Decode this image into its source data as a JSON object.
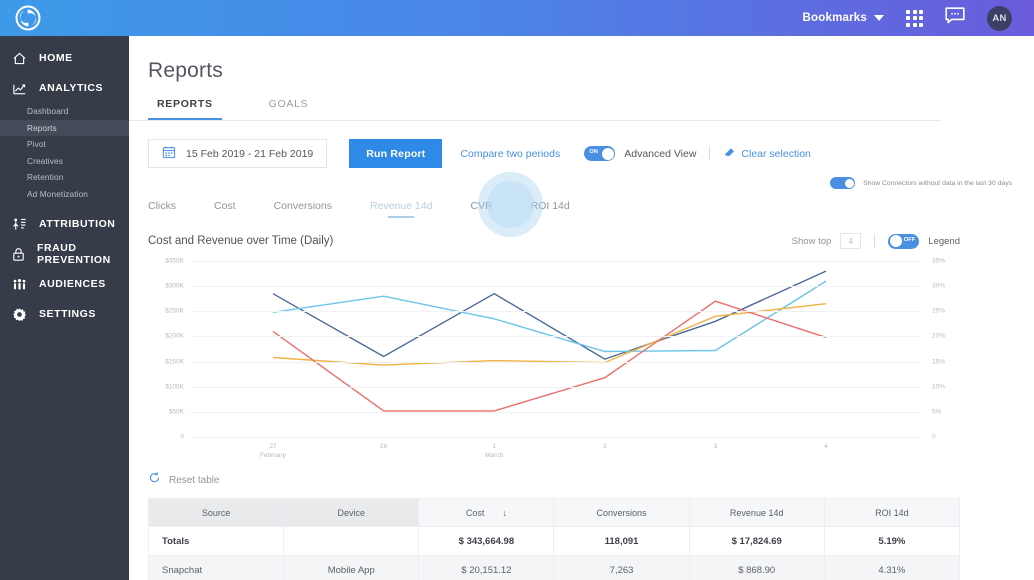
{
  "topbar": {
    "logo_name": "app-logo",
    "bookmarks_label": "Bookmarks",
    "grid_icon": "apps-grid-icon",
    "chat_icon": "chat-bubble-icon",
    "avatar_initials": "AN"
  },
  "sidebar": {
    "items": [
      {
        "label": "HOME",
        "icon": "home-icon",
        "key": "home"
      },
      {
        "label": "ANALYTICS",
        "icon": "analytics-chart-icon",
        "key": "analytics"
      },
      {
        "label": "ATTRIBUTION",
        "icon": "attribution-icon",
        "key": "attribution"
      },
      {
        "label": "FRAUD PREVENTION",
        "icon": "lock-icon",
        "key": "fraud-prevention"
      },
      {
        "label": "AUDIENCES",
        "icon": "people-icon",
        "key": "audiences"
      },
      {
        "label": "SETTINGS",
        "icon": "gear-icon",
        "key": "settings"
      }
    ],
    "analytics_sub": [
      {
        "label": "Dashboard",
        "key": "dashboard",
        "active": false
      },
      {
        "label": "Reports",
        "key": "reports",
        "active": true
      },
      {
        "label": "Pivot",
        "key": "pivot",
        "active": false
      },
      {
        "label": "Creatives",
        "key": "creatives",
        "active": false
      },
      {
        "label": "Retention",
        "key": "retention",
        "active": false
      },
      {
        "label": "Ad Monetization",
        "key": "ad-monetization",
        "active": false
      }
    ]
  },
  "page": {
    "title": "Reports",
    "tabs": [
      {
        "label": "REPORTS",
        "active": true
      },
      {
        "label": "GOALS",
        "active": false
      }
    ]
  },
  "toolbar": {
    "date_range": "15 Feb 2019 - 21 Feb 2019",
    "calendar_icon": "calendar-icon",
    "run_report_label": "Run Report",
    "compare_label": "Compare two periods",
    "advanced_view_label": "Advanced View",
    "advanced_view_toggle": "ON",
    "clear_selection_label": "Clear selection",
    "eraser_icon": "eraser-icon",
    "connectors_toggle": "ON",
    "connectors_label": "Show Connectors without data in the last 30 days"
  },
  "metric_tabs": [
    {
      "label": "Clicks",
      "selected": false
    },
    {
      "label": "Cost",
      "selected": false
    },
    {
      "label": "Conversions",
      "selected": false
    },
    {
      "label": "Revenue 14d",
      "selected": true
    },
    {
      "label": "CVR",
      "selected": false
    },
    {
      "label": "ROI 14d",
      "selected": false
    }
  ],
  "chart_panel": {
    "show_top_label": "Show top",
    "show_top_value": "4",
    "legend_label": "Legend",
    "legend_toggle": "OFF"
  },
  "chart_data": {
    "type": "line",
    "title": "Cost and Revenue over Time (Daily)",
    "xlabel": "",
    "ylabel": "",
    "grid": true,
    "legend_position": "hidden",
    "x": [
      "27",
      "28",
      "1",
      "2",
      "3",
      "4"
    ],
    "x_sublabels": [
      "February",
      "",
      "March",
      "",
      "",
      ""
    ],
    "y_left_ticks": [
      "0",
      "$50K",
      "$100K",
      "$150K",
      "$200K",
      "$250K",
      "$300K",
      "$350K"
    ],
    "y_left_range": [
      0,
      350000
    ],
    "y_right_ticks": [
      "0",
      "5%",
      "10%",
      "15%",
      "20%",
      "25%",
      "30%",
      "35%"
    ],
    "y_right_range": [
      0,
      35
    ],
    "series": [
      {
        "name": "series-navy",
        "color": "#4c6a96",
        "axis": "left",
        "values": [
          285000,
          160000,
          285000,
          155000,
          230000,
          330000
        ]
      },
      {
        "name": "series-lightblue",
        "color": "#6cc5e8",
        "axis": "left",
        "values": [
          248000,
          280000,
          235000,
          170000,
          172000,
          310000
        ]
      },
      {
        "name": "series-yellow",
        "color": "#f0b343",
        "axis": "left",
        "values": [
          158000,
          143000,
          152000,
          148000,
          240000,
          265000
        ]
      },
      {
        "name": "series-red",
        "color": "#e8706d",
        "axis": "left",
        "values": [
          210000,
          52000,
          52000,
          118000,
          270000,
          198000
        ]
      }
    ]
  },
  "table": {
    "reset_label": "Reset table",
    "reset_icon": "refresh-icon",
    "columns": [
      {
        "label": "Source",
        "dimension": true,
        "sorted": false
      },
      {
        "label": "Device",
        "dimension": true,
        "sorted": false
      },
      {
        "label": "Cost",
        "dimension": false,
        "sorted": true,
        "sort_dir": "↓"
      },
      {
        "label": "Conversions",
        "dimension": false,
        "sorted": false
      },
      {
        "label": "Revenue 14d",
        "dimension": false,
        "sorted": false
      },
      {
        "label": "ROI 14d",
        "dimension": false,
        "sorted": false
      }
    ],
    "rows": [
      {
        "source": "Totals",
        "device": "",
        "cost": "$ 343,664.98",
        "conversions": "118,091",
        "revenue": "$ 17,824.69",
        "roi": "5.19%",
        "totals": true
      },
      {
        "source": "Snapchat",
        "device": "Mobile App",
        "cost": "$ 20,151.12",
        "conversions": "7,263",
        "revenue": "$ 868.90",
        "roi": "4.31%",
        "totals": false
      }
    ]
  },
  "colors": {
    "accent": "#4a90e2",
    "brand_blue": "#2e8ae6",
    "sidebar_bg": "#363d49"
  }
}
